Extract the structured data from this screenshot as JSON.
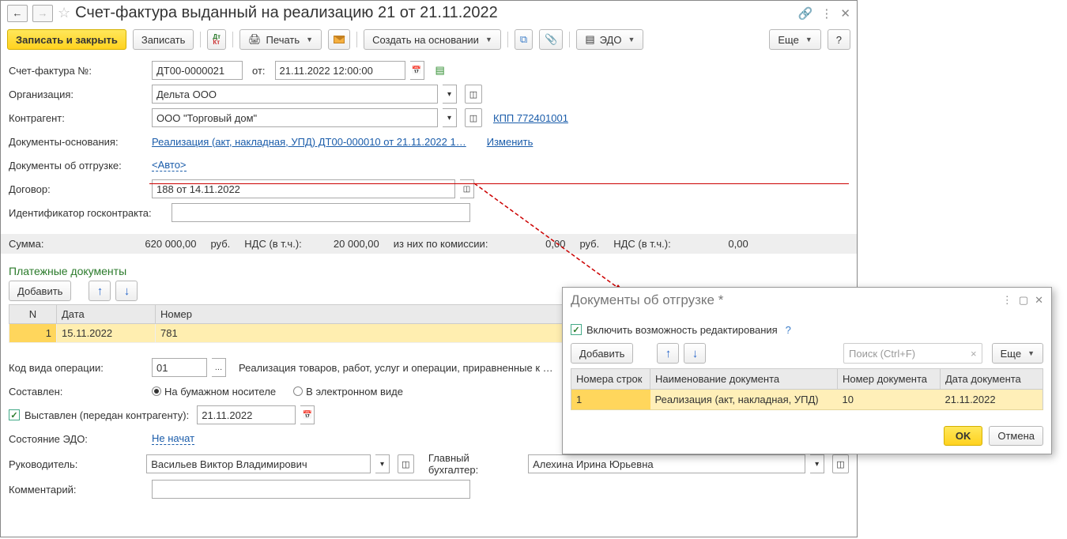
{
  "header": {
    "title": "Счет-фактура выданный на реализацию 21 от 21.11.2022"
  },
  "toolbar": {
    "save_close": "Записать и закрыть",
    "save": "Записать",
    "print": "Печать",
    "create_based": "Создать на основании",
    "edo": "ЭДО",
    "more": "Еще",
    "help": "?"
  },
  "fields": {
    "number_lbl": "Счет-фактура №:",
    "number": "ДТ00-0000021",
    "from_lbl": "от:",
    "date": "21.11.2022 12:00:00",
    "org_lbl": "Организация:",
    "org": "Дельта ООО",
    "counter_lbl": "Контрагент:",
    "counter": "ООО \"Торговый дом\"",
    "kpp": "КПП 772401001",
    "basis_lbl": "Документы-основания:",
    "basis": "Реализация (акт, накладная, УПД) ДТ00-000010 от 21.11.2022 1…",
    "change": "Изменить",
    "shipment_lbl": "Документы об отгрузке:",
    "shipment_link": "<Авто>",
    "contract_lbl": "Договор:",
    "contract": "188 от 14.11.2022",
    "goscontract_lbl": "Идентификатор госконтракта:",
    "goscontract": "",
    "code_lbl": "Код вида операции:",
    "code": "01",
    "code_desc": "Реализация товаров, работ, услуг и операции, приравненные к …",
    "composed_lbl": "Составлен:",
    "composed_paper": "На бумажном носителе",
    "composed_elec": "В электронном виде",
    "issued_lbl": "Выставлен (передан контрагенту):",
    "issued_date": "21.11.2022",
    "edo_state_lbl": "Состояние ЭДО:",
    "edo_state": "Не начат",
    "head_lbl": "Руководитель:",
    "head": "Васильев Виктор Владимирович",
    "accountant_lbl": "Главный бухгалтер:",
    "accountant": "Алехина Ирина Юрьевна",
    "comment_lbl": "Комментарий:",
    "comment": ""
  },
  "sums": {
    "sum_lbl": "Сумма:",
    "sum": "620 000,00",
    "rub": "руб.",
    "vat_lbl": "НДС (в т.ч.):",
    "vat": "20 000,00",
    "comm_lbl": "из них по комиссии:",
    "comm": "0,00",
    "vat2_lbl": "НДС (в т.ч.):",
    "vat2": "0,00"
  },
  "pay_section": {
    "title": "Платежные документы",
    "add": "Добавить",
    "col_n": "N",
    "col_date": "Дата",
    "col_num": "Номер",
    "row_n": "1",
    "row_date": "15.11.2022",
    "row_num": "781"
  },
  "popup": {
    "title": "Документы об отгрузке *",
    "enable_edit": "Включить возможность редактирования",
    "add": "Добавить",
    "search_ph": "Поиск (Ctrl+F)",
    "more": "Еще",
    "col_rows": "Номера строк",
    "col_name": "Наименование документа",
    "col_num": "Номер документа",
    "col_date": "Дата документа",
    "r_rows": "1",
    "r_name": "Реализация (акт, накладная, УПД)",
    "r_num": "10",
    "r_date": "21.11.2022",
    "ok": "OK",
    "cancel": "Отмена"
  }
}
